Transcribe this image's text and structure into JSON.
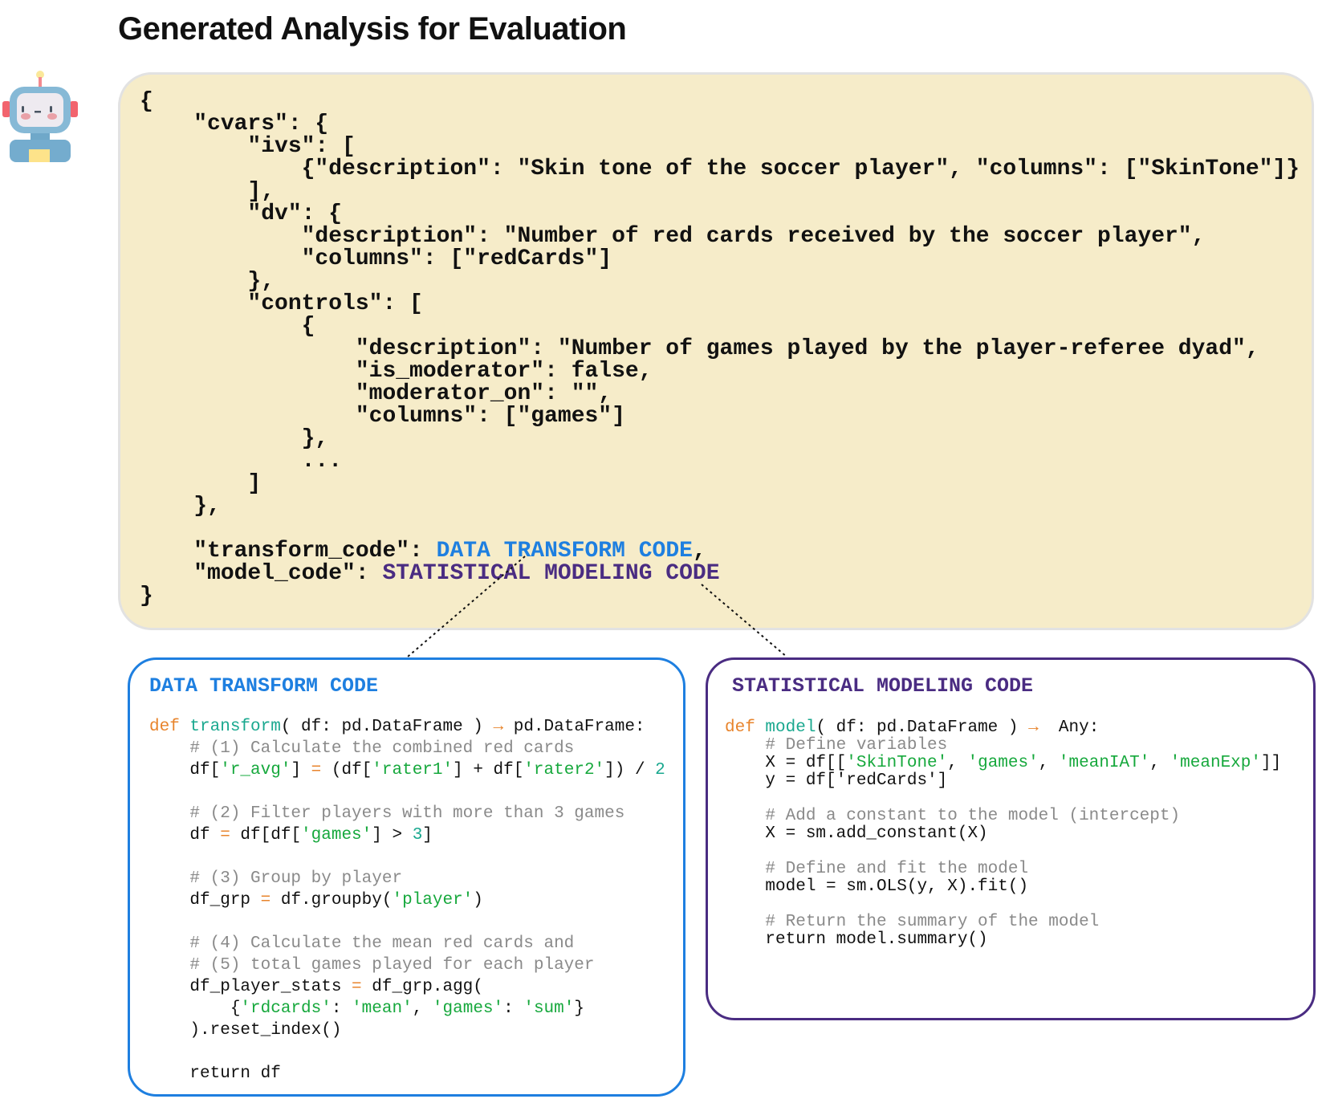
{
  "title": "Generated Analysis for Evaluation",
  "icons": {
    "avatar": "robot-icon"
  },
  "colors": {
    "transform": "#1e7fe0",
    "model": "#4a2c82",
    "panel_bg": "#f6ecc9",
    "keyword": "#e8842c",
    "function": "#1aa88f",
    "string": "#16a83c",
    "comment": "#8a8a8a"
  },
  "json_panel": {
    "lines": [
      [
        [
          "{",
          ""
        ]
      ],
      [
        [
          "    \"cvars\": {",
          ""
        ]
      ],
      [
        [
          "        \"ivs\": [",
          ""
        ]
      ],
      [
        [
          "            {\"description\": \"Skin tone of the soccer player\", \"columns\": [\"SkinTone\"]}",
          ""
        ]
      ],
      [
        [
          "        ],",
          ""
        ]
      ],
      [
        [
          "        \"dv\": {",
          ""
        ]
      ],
      [
        [
          "            \"description\": \"Number of red cards received by the soccer player\",",
          ""
        ]
      ],
      [
        [
          "            \"columns\": [\"redCards\"]",
          ""
        ]
      ],
      [
        [
          "        },",
          ""
        ]
      ],
      [
        [
          "        \"controls\": [",
          ""
        ]
      ],
      [
        [
          "            {",
          ""
        ]
      ],
      [
        [
          "                \"description\": \"Number of games played by the player-referee dyad\",",
          ""
        ]
      ],
      [
        [
          "                \"is_moderator\": false,",
          ""
        ]
      ],
      [
        [
          "                \"moderator_on\": \"\",",
          ""
        ]
      ],
      [
        [
          "                \"columns\": [\"games\"]",
          ""
        ]
      ],
      [
        [
          "            },",
          ""
        ]
      ],
      [
        [
          "            ...",
          ""
        ]
      ],
      [
        [
          "        ]",
          ""
        ]
      ],
      [
        [
          "    },",
          ""
        ]
      ],
      [
        [
          "",
          ""
        ]
      ],
      [
        [
          "    \"transform_code\": ",
          ""
        ],
        [
          "DATA TRANSFORM CODE",
          "blue"
        ],
        [
          ",",
          ""
        ]
      ],
      [
        [
          "    \"model_code\": ",
          ""
        ],
        [
          "STATISTICAL MODELING CODE",
          "purple"
        ]
      ],
      [
        [
          "}",
          ""
        ]
      ]
    ]
  },
  "transform_box": {
    "title": "DATA TRANSFORM CODE",
    "lines": [
      [
        [
          "def ",
          "k"
        ],
        [
          "transform",
          "f"
        ],
        [
          "( df: pd.DataFrame ) ",
          ""
        ],
        [
          "→",
          "o"
        ],
        [
          " pd.DataFrame:",
          ""
        ]
      ],
      [
        [
          "    # (1) Calculate the combined red cards",
          "c"
        ]
      ],
      [
        [
          "    df[",
          ""
        ],
        [
          "'r_avg'",
          "s"
        ],
        [
          "] ",
          ""
        ],
        [
          "=",
          "o"
        ],
        [
          " (df[",
          ""
        ],
        [
          "'rater1'",
          "s"
        ],
        [
          "] + df[",
          ""
        ],
        [
          "'rater2'",
          "s"
        ],
        [
          "]) / ",
          ""
        ],
        [
          "2",
          "n"
        ]
      ],
      [
        [
          "",
          ""
        ]
      ],
      [
        [
          "    # (2) Filter players with more than 3 games",
          "c"
        ]
      ],
      [
        [
          "    df ",
          ""
        ],
        [
          "=",
          "o"
        ],
        [
          " df[df[",
          ""
        ],
        [
          "'games'",
          "s"
        ],
        [
          "] > ",
          ""
        ],
        [
          "3",
          "n"
        ],
        [
          "]",
          ""
        ]
      ],
      [
        [
          "",
          ""
        ]
      ],
      [
        [
          "    # (3) Group by player",
          "c"
        ]
      ],
      [
        [
          "    df_grp ",
          ""
        ],
        [
          "=",
          "o"
        ],
        [
          " df.groupby(",
          ""
        ],
        [
          "'player'",
          "s"
        ],
        [
          ")",
          ""
        ]
      ],
      [
        [
          "",
          ""
        ]
      ],
      [
        [
          "    # (4) Calculate the mean red cards and",
          "c"
        ]
      ],
      [
        [
          "    # (5) total games played for each player",
          "c"
        ]
      ],
      [
        [
          "    df_player_stats ",
          ""
        ],
        [
          "=",
          "o"
        ],
        [
          " df_grp.agg(",
          ""
        ]
      ],
      [
        [
          "        {",
          ""
        ],
        [
          "'rdcards'",
          "s"
        ],
        [
          ": ",
          ""
        ],
        [
          "'mean'",
          "s"
        ],
        [
          ", ",
          ""
        ],
        [
          "'games'",
          "s"
        ],
        [
          ": ",
          ""
        ],
        [
          "'sum'",
          "s"
        ],
        [
          "}",
          ""
        ]
      ],
      [
        [
          "    ).reset_index()",
          ""
        ]
      ],
      [
        [
          "",
          ""
        ]
      ],
      [
        [
          "    return df",
          ""
        ]
      ]
    ]
  },
  "model_box": {
    "title": "STATISTICAL MODELING CODE",
    "lines": [
      [
        [
          "def ",
          "k"
        ],
        [
          "model",
          "f"
        ],
        [
          "( df: pd.DataFrame ) ",
          ""
        ],
        [
          "→",
          "o"
        ],
        [
          "  Any:",
          ""
        ]
      ],
      [
        [
          "    # Define variables",
          "c"
        ]
      ],
      [
        [
          "    X = df[[",
          ""
        ],
        [
          "'SkinTone'",
          "s"
        ],
        [
          ", ",
          ""
        ],
        [
          "'games'",
          "s"
        ],
        [
          ", ",
          ""
        ],
        [
          "'meanIAT'",
          "s"
        ],
        [
          ", ",
          ""
        ],
        [
          "'meanExp'",
          "s"
        ],
        [
          "]]",
          ""
        ]
      ],
      [
        [
          "    y = df['redCards']",
          ""
        ]
      ],
      [
        [
          "",
          ""
        ]
      ],
      [
        [
          "    # Add a constant to the model (intercept)",
          "c"
        ]
      ],
      [
        [
          "    X = sm.add_constant(X)",
          ""
        ]
      ],
      [
        [
          "",
          ""
        ]
      ],
      [
        [
          "    # Define and fit the model",
          "c"
        ]
      ],
      [
        [
          "    model = sm.OLS(y, X).fit()",
          ""
        ]
      ],
      [
        [
          "",
          ""
        ]
      ],
      [
        [
          "    # Return the summary of the model",
          "c"
        ]
      ],
      [
        [
          "    return model.summary()",
          ""
        ]
      ]
    ]
  }
}
